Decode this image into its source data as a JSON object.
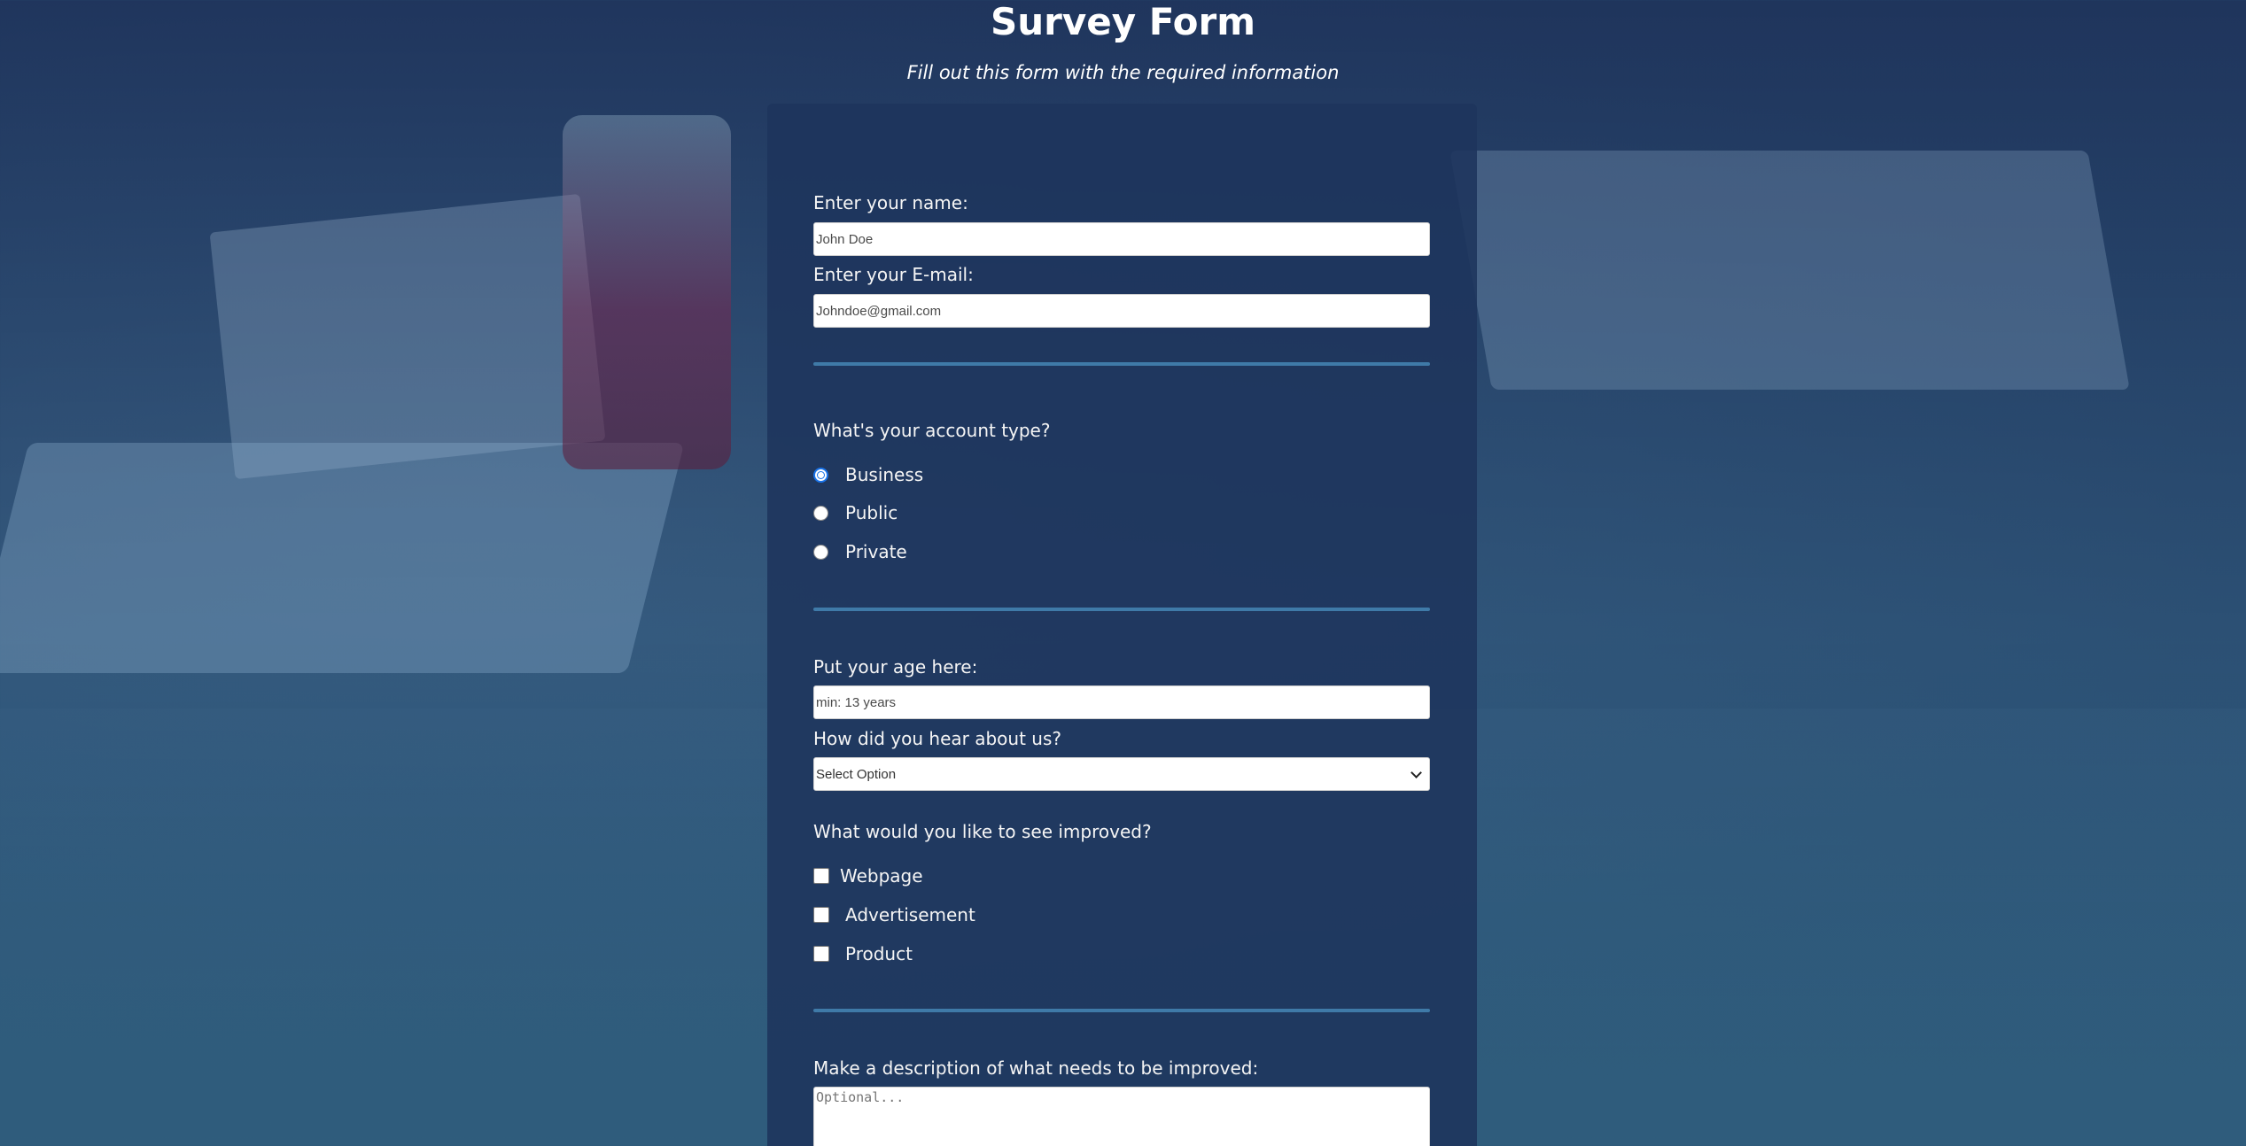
{
  "header": {
    "title": "Survey Form",
    "subtitle": "Fill out this form with the required information"
  },
  "form": {
    "name": {
      "label": "Enter your name:",
      "placeholder": "John Doe",
      "value": ""
    },
    "email": {
      "label": "Enter your E-mail:",
      "placeholder": "Johndoe@gmail.com",
      "value": ""
    },
    "account_type": {
      "question": "What's your account type?",
      "options": [
        {
          "label": "Business",
          "checked": true
        },
        {
          "label": "Public",
          "checked": false
        },
        {
          "label": "Private",
          "checked": false
        }
      ]
    },
    "age": {
      "label": "Put your age here:",
      "placeholder": "min: 13 years",
      "value": ""
    },
    "referral": {
      "label": "How did you hear about us?",
      "selected": "Select Option"
    },
    "improvements": {
      "question": "What would you like to see improved?",
      "options": [
        {
          "label": "Webpage",
          "checked": false
        },
        {
          "label": "Advertisement",
          "checked": false
        },
        {
          "label": "Product",
          "checked": false
        }
      ]
    },
    "description": {
      "label": "Make a description of what needs to be improved:",
      "placeholder": "Optional..."
    }
  },
  "colors": {
    "card_background": "#1e345c",
    "divider": "#3f7aa8",
    "radio_accent": "#1a73e8"
  }
}
